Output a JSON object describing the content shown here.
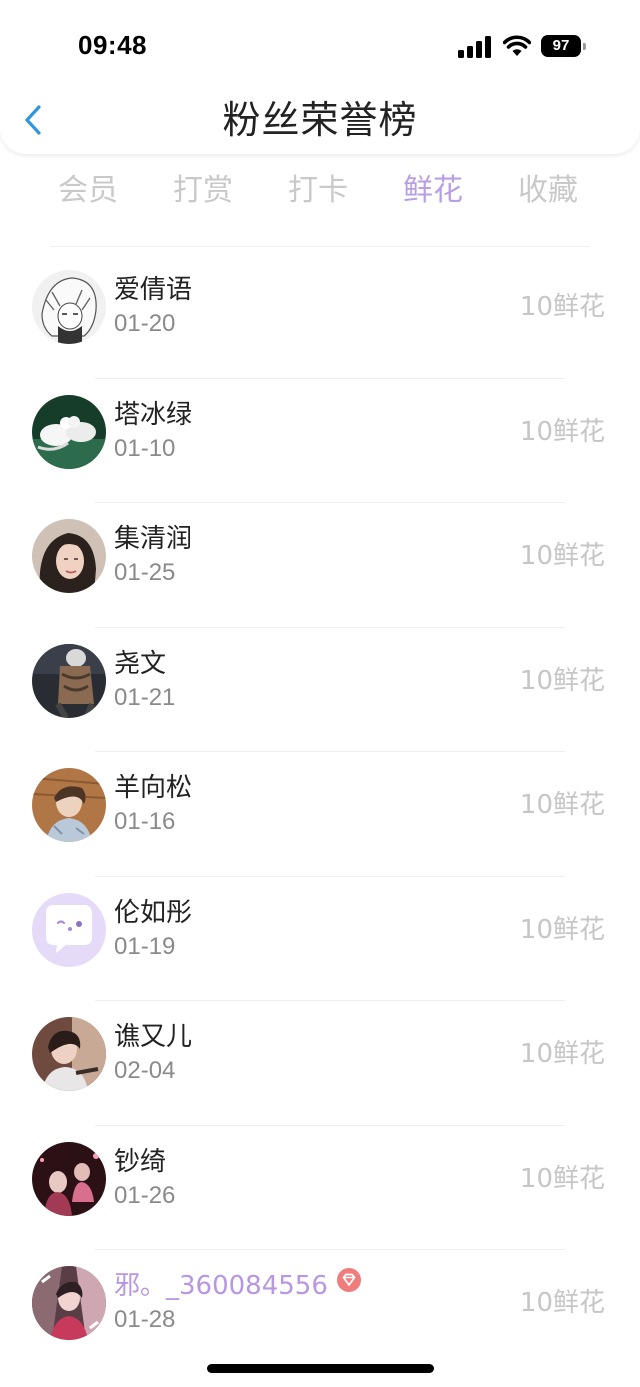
{
  "status_bar": {
    "time": "09:48",
    "battery": "97",
    "icons": [
      "signal-icon",
      "wifi-icon",
      "battery-icon"
    ]
  },
  "nav": {
    "title": "粉丝荣誉榜",
    "back_icon": "chevron-left-icon",
    "accent_color": "#2f96e0"
  },
  "tabs": [
    {
      "label": "会员",
      "active": false
    },
    {
      "label": "打赏",
      "active": false
    },
    {
      "label": "打卡",
      "active": false
    },
    {
      "label": "鲜花",
      "active": true
    },
    {
      "label": "收藏",
      "active": false
    }
  ],
  "colors": {
    "tab_active": "#b99ee3",
    "tab_inactive": "#c9c9c9",
    "vip_name": "#b796e2",
    "vip_badge": "#f07c7c"
  },
  "list": [
    {
      "name": "爱倩语",
      "date": "01-20",
      "amount": "10鲜花"
    },
    {
      "name": "塔冰绿",
      "date": "01-10",
      "amount": "10鲜花"
    },
    {
      "name": "集清润",
      "date": "01-25",
      "amount": "10鲜花"
    },
    {
      "name": "尧文",
      "date": "01-21",
      "amount": "10鲜花"
    },
    {
      "name": "羊向松",
      "date": "01-16",
      "amount": "10鲜花"
    },
    {
      "name": "伦如彤",
      "date": "01-19",
      "amount": "10鲜花"
    },
    {
      "name": "谯又儿",
      "date": "02-04",
      "amount": "10鲜花"
    },
    {
      "name": "钞绮",
      "date": "01-26",
      "amount": "10鲜花"
    },
    {
      "name": "邪。_360084556",
      "date": "01-28",
      "amount": "10鲜花",
      "vip": true,
      "badge_icon": "diamond-badge-icon"
    }
  ]
}
